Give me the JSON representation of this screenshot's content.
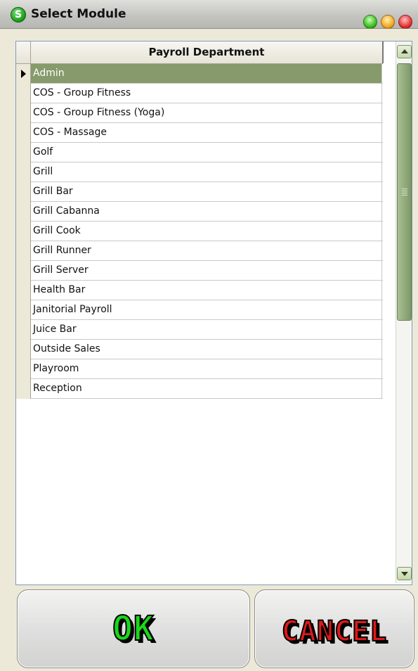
{
  "window": {
    "title": "Select Module",
    "app_icon_letter": "S"
  },
  "grid": {
    "column_header": "Payroll Department",
    "selected_index": 0,
    "rows": [
      "Admin",
      "COS - Group Fitness",
      "COS - Group Fitness (Yoga)",
      "COS - Massage",
      "Golf",
      "Grill",
      "Grill Bar",
      "Grill Cabanna",
      "Grill Cook",
      "Grill Runner",
      "Grill Server",
      "Health Bar",
      "Janitorial Payroll",
      "Juice Bar",
      "Outside Sales",
      "Playroom",
      "Reception"
    ]
  },
  "buttons": {
    "ok_label": "OK",
    "cancel_label": "CANCEL"
  },
  "colors": {
    "selected_row": "#879a6b",
    "ok_text": "#1bd61b",
    "cancel_text": "#e01818"
  }
}
